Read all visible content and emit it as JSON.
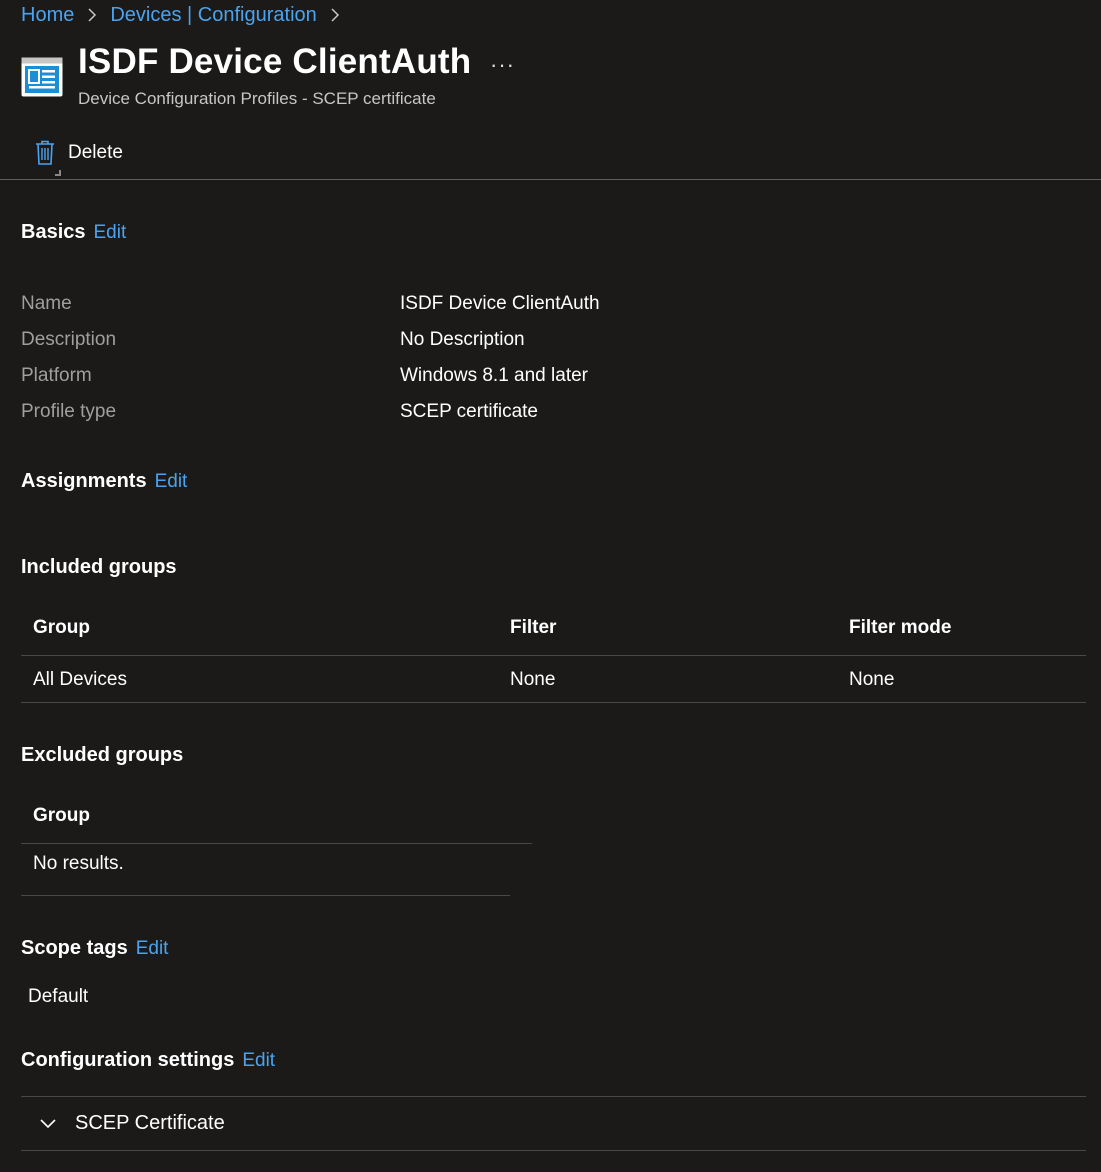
{
  "breadcrumb": {
    "home": "Home",
    "devices": "Devices | Configuration"
  },
  "header": {
    "title": "ISDF Device ClientAuth",
    "more": "···",
    "subtitle": "Device Configuration Profiles - SCEP certificate"
  },
  "toolbar": {
    "delete_label": "Delete"
  },
  "basics": {
    "title": "Basics",
    "edit": "Edit",
    "rows": [
      {
        "label": "Name",
        "value": "ISDF Device ClientAuth"
      },
      {
        "label": "Description",
        "value": "No Description"
      },
      {
        "label": "Platform",
        "value": "Windows 8.1 and later"
      },
      {
        "label": "Profile type",
        "value": "SCEP certificate"
      }
    ]
  },
  "assignments": {
    "title": "Assignments",
    "edit": "Edit",
    "included": {
      "title": "Included groups",
      "headers": [
        "Group",
        "Filter",
        "Filter mode"
      ],
      "rows": [
        [
          "All Devices",
          "None",
          "None"
        ]
      ]
    },
    "excluded": {
      "title": "Excluded groups",
      "header": "Group",
      "empty": "No results."
    }
  },
  "scope_tags": {
    "title": "Scope tags",
    "edit": "Edit",
    "value": "Default"
  },
  "configuration": {
    "title": "Configuration settings",
    "edit": "Edit",
    "accordion_label": "SCEP Certificate"
  },
  "colors": {
    "background": "#1b1a19",
    "link": "#4aa3f0",
    "muted": "#a19f9d"
  }
}
